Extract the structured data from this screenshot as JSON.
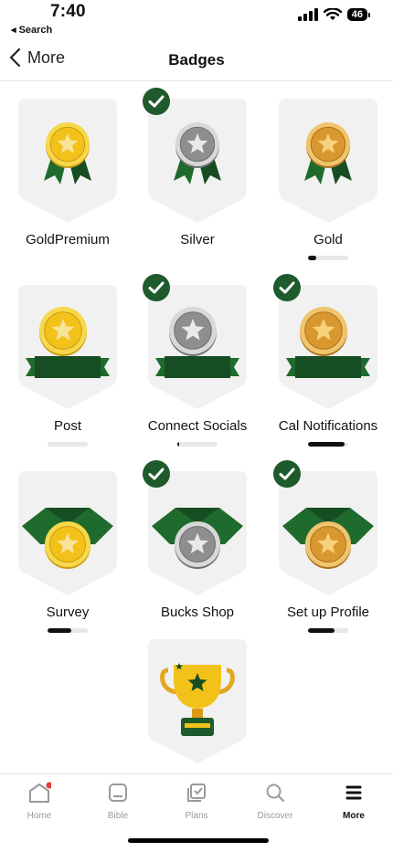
{
  "status": {
    "time": "7:40",
    "back_app": "◂ Search",
    "battery": "46"
  },
  "header": {
    "back_label": "More",
    "title": "Badges"
  },
  "badges": [
    {
      "label": "GoldPremium",
      "earned": false,
      "medal": "gold",
      "style": "ribbon",
      "progress": null
    },
    {
      "label": "Silver",
      "earned": true,
      "medal": "silver",
      "style": "ribbon",
      "progress": null
    },
    {
      "label": "Gold",
      "earned": false,
      "medal": "bronze",
      "style": "ribbon",
      "progress": 0.2
    },
    {
      "label": "Post",
      "earned": false,
      "medal": "gold",
      "style": "banner",
      "progress": 0
    },
    {
      "label": "Connect Socials",
      "earned": true,
      "medal": "silver",
      "style": "banner",
      "progress": 0.05
    },
    {
      "label": "Cal Notifications",
      "earned": true,
      "medal": "bronze",
      "style": "banner",
      "progress": 0.9
    },
    {
      "label": "Survey",
      "earned": false,
      "medal": "gold",
      "style": "collar",
      "progress": 0.6
    },
    {
      "label": "Bucks Shop",
      "earned": true,
      "medal": "silver",
      "style": "collar",
      "progress": null
    },
    {
      "label": "Set up Profile",
      "earned": true,
      "medal": "bronze",
      "style": "collar",
      "progress": 0.65
    },
    {
      "label": "",
      "earned": false,
      "medal": "trophy",
      "style": "trophy",
      "progress": null
    }
  ],
  "tabs": [
    {
      "label": "Home",
      "icon": "home-icon",
      "active": false,
      "notification_dot": true
    },
    {
      "label": "Bible",
      "icon": "bible-icon",
      "active": false,
      "notification_dot": false
    },
    {
      "label": "Plans",
      "icon": "plans-icon",
      "active": false,
      "notification_dot": false
    },
    {
      "label": "Discover",
      "icon": "discover-icon",
      "active": false,
      "notification_dot": false
    },
    {
      "label": "More",
      "icon": "menu-icon",
      "active": true,
      "notification_dot": false
    }
  ],
  "colors": {
    "check_green": "#1e5a2c",
    "ribbon_green": "#1f6b2d",
    "ribbon_dark": "#174d22",
    "shield_bg": "#f1f1f1",
    "gold": "#f3c21a",
    "silver": "#9b9b9b",
    "bronze": "#dca03a",
    "notification_red": "#e53935"
  }
}
